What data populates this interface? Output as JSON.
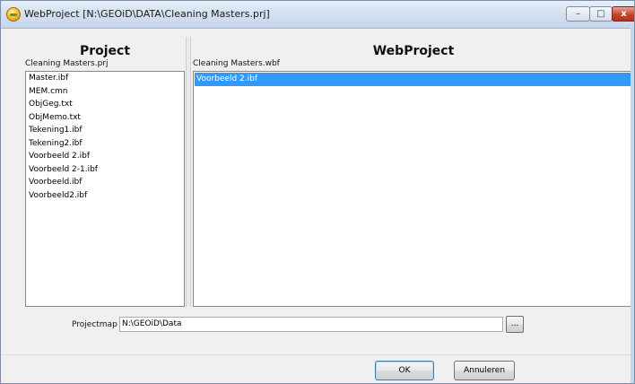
{
  "window": {
    "title": "WebProject [N:\\GEOiD\\DATA\\Cleaning Masters.prj]",
    "min_label": "–",
    "max_label": "□",
    "close_label": "x"
  },
  "project": {
    "title": "Project",
    "file": "Cleaning Masters.prj",
    "items": [
      "Master.ibf",
      "MEM.cmn",
      "ObjGeg.txt",
      "ObjMemo.txt",
      "Tekening1.ibf",
      "Tekening2.ibf",
      "Voorbeeld 2.ibf",
      "Voorbeeld 2-1.ibf",
      "Voorbeeld.ibf",
      "Voorbeeld2.ibf"
    ]
  },
  "webproject": {
    "title": "WebProject",
    "file": "Cleaning Masters.wbf",
    "items": [
      "Voorbeeld 2.ibf"
    ],
    "selected_index": 0
  },
  "projectmap": {
    "label": "Projectmap",
    "value": "N:\\GEOiD\\Data",
    "browse_label": "..."
  },
  "buttons": {
    "ok": "OK",
    "cancel": "Annuleren"
  },
  "colors": {
    "selection": "#3399ff",
    "close_button": "#c4442b"
  }
}
